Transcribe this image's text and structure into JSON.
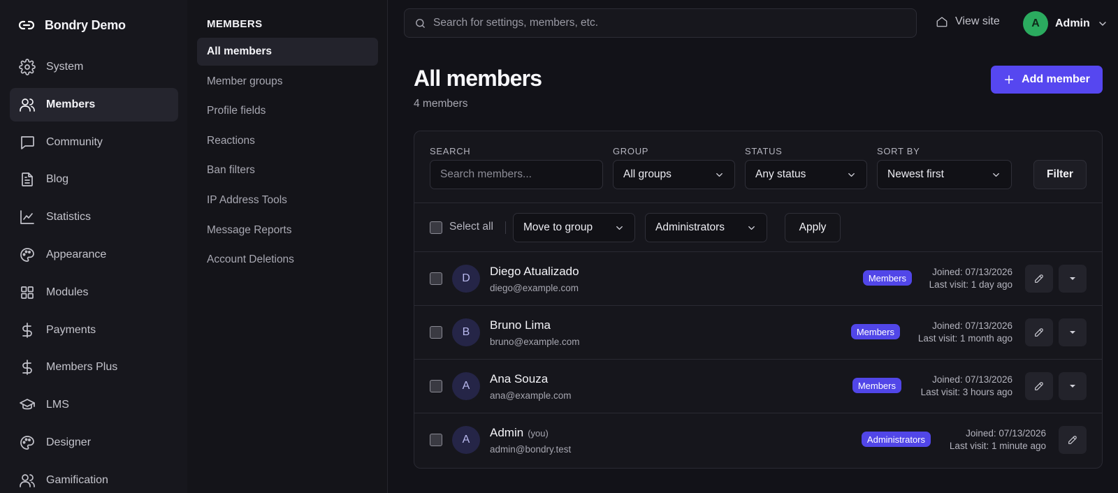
{
  "brand": {
    "name": "Bondry Demo",
    "icon": "link-icon"
  },
  "nav": {
    "items": [
      {
        "label": "System",
        "icon": "gear-icon",
        "active": false
      },
      {
        "label": "Members",
        "icon": "users-icon",
        "active": true
      },
      {
        "label": "Community",
        "icon": "chat-icon",
        "active": false
      },
      {
        "label": "Blog",
        "icon": "document-icon",
        "active": false
      },
      {
        "label": "Statistics",
        "icon": "chart-line-icon",
        "active": false
      },
      {
        "label": "Appearance",
        "icon": "palette-icon",
        "active": false
      },
      {
        "label": "Modules",
        "icon": "grid-icon",
        "active": false
      },
      {
        "label": "Payments",
        "icon": "dollar-icon",
        "active": false
      },
      {
        "label": "Members Plus",
        "icon": "dollar-icon",
        "active": false
      },
      {
        "label": "LMS",
        "icon": "graduation-cap-icon",
        "active": false
      },
      {
        "label": "Designer",
        "icon": "palette-icon",
        "active": false
      },
      {
        "label": "Gamification",
        "icon": "users-icon",
        "active": false
      }
    ]
  },
  "subnav": {
    "heading": "MEMBERS",
    "items": [
      {
        "label": "All members",
        "active": true
      },
      {
        "label": "Member groups",
        "active": false
      },
      {
        "label": "Profile fields",
        "active": false
      },
      {
        "label": "Reactions",
        "active": false
      },
      {
        "label": "Ban filters",
        "active": false
      },
      {
        "label": "IP Address Tools",
        "active": false
      },
      {
        "label": "Message Reports",
        "active": false
      },
      {
        "label": "Account Deletions",
        "active": false
      }
    ]
  },
  "topbar": {
    "search_placeholder": "Search for settings, members, etc.",
    "view_site": "View site",
    "user": {
      "initial": "A",
      "name": "Admin",
      "avatar_color": "#2bab5f"
    }
  },
  "header": {
    "title": "All members",
    "count": "4 members",
    "add_button": "Add member",
    "accent": "#5647f0"
  },
  "filters": {
    "search": {
      "label": "SEARCH",
      "placeholder": "Search members..."
    },
    "group": {
      "label": "GROUP",
      "value": "All groups"
    },
    "status": {
      "label": "STATUS",
      "value": "Any status"
    },
    "sort": {
      "label": "SORT BY",
      "value": "Newest first"
    },
    "filter_button": "Filter"
  },
  "bulk": {
    "select_all": "Select all",
    "action": "Move to group",
    "target": "Administrators",
    "apply": "Apply"
  },
  "members": [
    {
      "initial": "D",
      "name": "Diego Atualizado",
      "you": "",
      "email": "diego@example.com",
      "group": "Members",
      "joined": "Joined: 07/13/2026",
      "last_visit": "Last visit: 1 day ago",
      "has_menu": true
    },
    {
      "initial": "B",
      "name": "Bruno Lima",
      "you": "",
      "email": "bruno@example.com",
      "group": "Members",
      "joined": "Joined: 07/13/2026",
      "last_visit": "Last visit: 1 month ago",
      "has_menu": true
    },
    {
      "initial": "A",
      "name": "Ana Souza",
      "you": "",
      "email": "ana@example.com",
      "group": "Members",
      "joined": "Joined: 07/13/2026",
      "last_visit": "Last visit: 3 hours ago",
      "has_menu": true
    },
    {
      "initial": "A",
      "name": "Admin",
      "you": "(you)",
      "email": "admin@bondry.test",
      "group": "Administrators",
      "joined": "Joined: 07/13/2026",
      "last_visit": "Last visit: 1 minute ago",
      "has_menu": false
    }
  ]
}
